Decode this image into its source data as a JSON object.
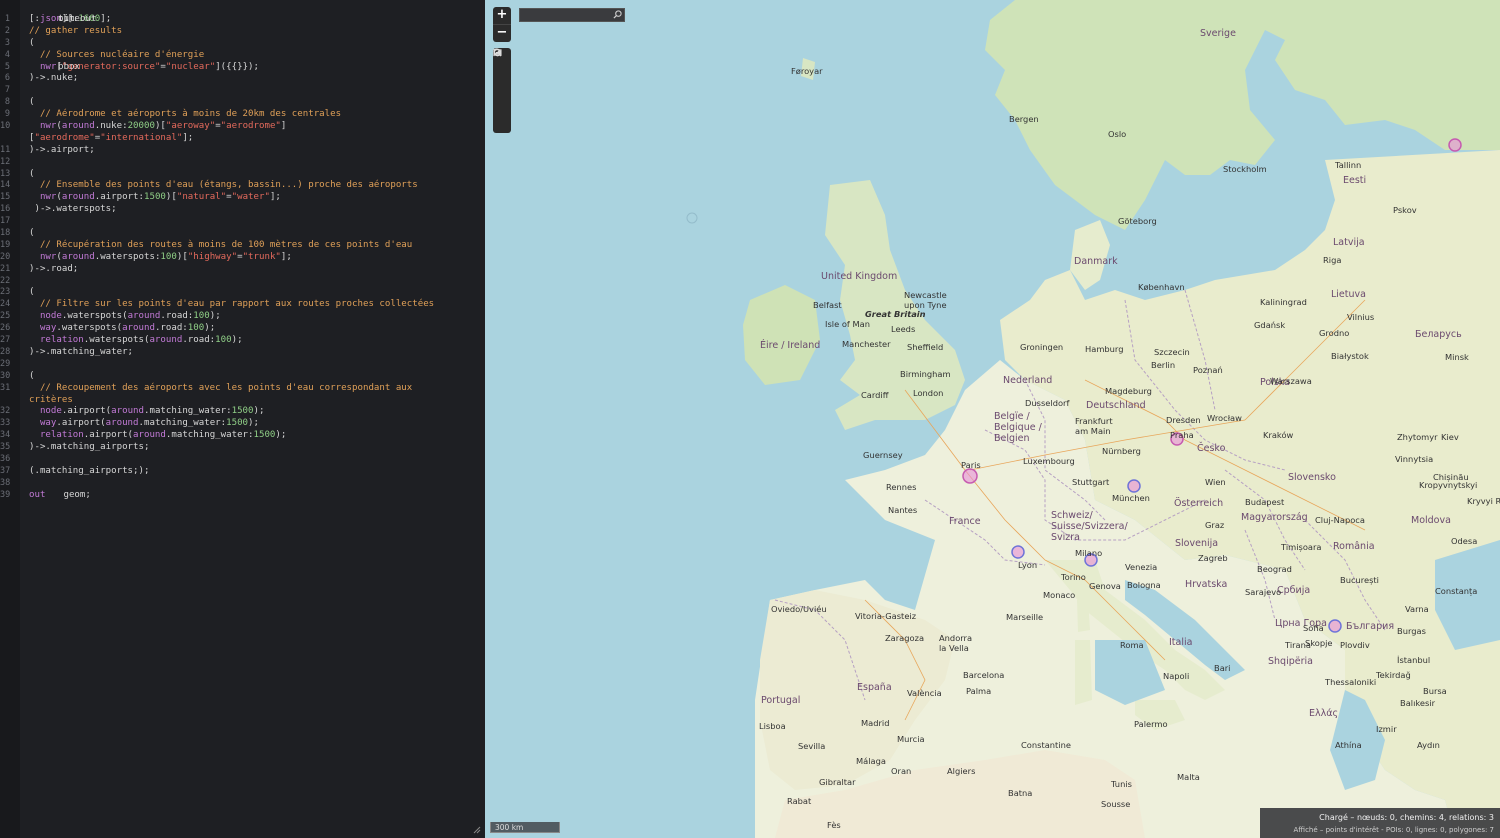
{
  "editor": {
    "lines": [
      {
        "n": "1",
        "segs": [
          [
            "op",
            "["
          ],
          [
            "txt",
            "out"
          ],
          [
            "op",
            ":"
          ],
          [
            "kw",
            "json"
          ],
          [
            "op",
            "]["
          ],
          [
            "txt",
            "timeout"
          ],
          [
            "op",
            ":"
          ],
          [
            "num",
            "1600"
          ],
          [
            "op",
            "];"
          ]
        ]
      },
      {
        "n": "2",
        "segs": [
          [
            "cm",
            "// gather results"
          ]
        ]
      },
      {
        "n": "3",
        "segs": [
          [
            "op",
            "("
          ]
        ]
      },
      {
        "n": "4",
        "segs": [
          [
            "cm",
            "  // Sources nucléaire d'énergie"
          ]
        ]
      },
      {
        "n": "5",
        "segs": [
          [
            "kw",
            "  nwr"
          ],
          [
            "op",
            "["
          ],
          [
            "str",
            "\"generator:source\""
          ],
          [
            "op",
            "="
          ],
          [
            "str",
            "\"nuclear\""
          ],
          [
            "op",
            "]({{"
          ],
          [
            "txt",
            "bbox"
          ],
          [
            "op",
            "}});"
          ]
        ]
      },
      {
        "n": "6",
        "segs": [
          [
            "op",
            ")->.nuke;"
          ]
        ]
      },
      {
        "n": "7",
        "segs": []
      },
      {
        "n": "8",
        "segs": [
          [
            "op",
            "("
          ]
        ]
      },
      {
        "n": "9",
        "segs": [
          [
            "cm",
            "  // Aérodrome et aéroports à moins de 20km des centrales"
          ]
        ]
      },
      {
        "n": "10",
        "segs": [
          [
            "kw",
            "  nwr"
          ],
          [
            "op",
            "("
          ],
          [
            "kw",
            "around"
          ],
          [
            "op",
            ".nuke:"
          ],
          [
            "num",
            "20000"
          ],
          [
            "op",
            ")["
          ],
          [
            "str",
            "\"aeroway\""
          ],
          [
            "op",
            "="
          ],
          [
            "str",
            "\"aerodrome\""
          ],
          [
            "op",
            "]"
          ]
        ]
      },
      {
        "n": "",
        "segs": [
          [
            "op",
            "["
          ],
          [
            "str",
            "\"aerodrome\""
          ],
          [
            "op",
            "="
          ],
          [
            "str",
            "\"international\""
          ],
          [
            "op",
            "];"
          ]
        ]
      },
      {
        "n": "11",
        "segs": [
          [
            "op",
            ")->.airport;"
          ]
        ]
      },
      {
        "n": "12",
        "segs": []
      },
      {
        "n": "13",
        "segs": [
          [
            "op",
            "("
          ]
        ]
      },
      {
        "n": "14",
        "segs": [
          [
            "cm",
            "  // Ensemble des points d'eau (étangs, bassin...) proche des aéroports"
          ]
        ]
      },
      {
        "n": "15",
        "segs": [
          [
            "kw",
            "  nwr"
          ],
          [
            "op",
            "("
          ],
          [
            "kw",
            "around"
          ],
          [
            "op",
            ".airport:"
          ],
          [
            "num",
            "1500"
          ],
          [
            "op",
            ")["
          ],
          [
            "str",
            "\"natural\""
          ],
          [
            "op",
            "="
          ],
          [
            "str",
            "\"water\""
          ],
          [
            "op",
            "];"
          ]
        ]
      },
      {
        "n": "16",
        "segs": [
          [
            "op",
            " )->.waterspots;"
          ]
        ]
      },
      {
        "n": "17",
        "segs": []
      },
      {
        "n": "18",
        "segs": [
          [
            "op",
            "("
          ]
        ]
      },
      {
        "n": "19",
        "segs": [
          [
            "cm",
            "  // Récupération des routes à moins de 100 mètres de ces points d'eau"
          ]
        ]
      },
      {
        "n": "20",
        "segs": [
          [
            "kw",
            "  nwr"
          ],
          [
            "op",
            "("
          ],
          [
            "kw",
            "around"
          ],
          [
            "op",
            ".waterspots:"
          ],
          [
            "num",
            "100"
          ],
          [
            "op",
            ")["
          ],
          [
            "str",
            "\"highway\""
          ],
          [
            "op",
            "="
          ],
          [
            "str",
            "\"trunk\""
          ],
          [
            "op",
            "];"
          ]
        ]
      },
      {
        "n": "21",
        "segs": [
          [
            "op",
            ")->.road;"
          ]
        ]
      },
      {
        "n": "22",
        "segs": []
      },
      {
        "n": "23",
        "segs": [
          [
            "op",
            "("
          ]
        ]
      },
      {
        "n": "24",
        "segs": [
          [
            "cm",
            "  // Filtre sur les points d'eau par rapport aux routes proches collectées"
          ]
        ]
      },
      {
        "n": "25",
        "segs": [
          [
            "kw",
            "  node"
          ],
          [
            "op",
            ".waterspots("
          ],
          [
            "kw",
            "around"
          ],
          [
            "op",
            ".road:"
          ],
          [
            "num",
            "100"
          ],
          [
            "op",
            ");"
          ]
        ]
      },
      {
        "n": "26",
        "segs": [
          [
            "kw",
            "  way"
          ],
          [
            "op",
            ".waterspots("
          ],
          [
            "kw",
            "around"
          ],
          [
            "op",
            ".road:"
          ],
          [
            "num",
            "100"
          ],
          [
            "op",
            ");"
          ]
        ]
      },
      {
        "n": "27",
        "segs": [
          [
            "kw",
            "  relation"
          ],
          [
            "op",
            ".waterspots("
          ],
          [
            "kw",
            "around"
          ],
          [
            "op",
            ".road:"
          ],
          [
            "num",
            "100"
          ],
          [
            "op",
            ");"
          ]
        ]
      },
      {
        "n": "28",
        "segs": [
          [
            "op",
            ")->.matching_water;"
          ]
        ]
      },
      {
        "n": "29",
        "segs": []
      },
      {
        "n": "30",
        "segs": [
          [
            "op",
            "("
          ]
        ]
      },
      {
        "n": "31",
        "segs": [
          [
            "cm",
            "  // Recoupement des aéroports avec les points d'eau correspondant aux"
          ]
        ]
      },
      {
        "n": "",
        "segs": [
          [
            "cm",
            "critères"
          ]
        ]
      },
      {
        "n": "32",
        "segs": [
          [
            "kw",
            "  node"
          ],
          [
            "op",
            ".airport("
          ],
          [
            "kw",
            "around"
          ],
          [
            "op",
            ".matching_water:"
          ],
          [
            "num",
            "1500"
          ],
          [
            "op",
            ");"
          ]
        ]
      },
      {
        "n": "33",
        "segs": [
          [
            "kw",
            "  way"
          ],
          [
            "op",
            ".airport("
          ],
          [
            "kw",
            "around"
          ],
          [
            "op",
            ".matching_water:"
          ],
          [
            "num",
            "1500"
          ],
          [
            "op",
            ");"
          ]
        ]
      },
      {
        "n": "34",
        "segs": [
          [
            "kw",
            "  relation"
          ],
          [
            "op",
            ".airport("
          ],
          [
            "kw",
            "around"
          ],
          [
            "op",
            ".matching_water:"
          ],
          [
            "num",
            "1500"
          ],
          [
            "op",
            ");"
          ]
        ]
      },
      {
        "n": "35",
        "segs": [
          [
            "op",
            ")->.matching_airports;"
          ]
        ]
      },
      {
        "n": "36",
        "segs": []
      },
      {
        "n": "37",
        "segs": [
          [
            "op",
            "(.matching_airports;);"
          ]
        ]
      },
      {
        "n": "38",
        "segs": []
      },
      {
        "n": "39",
        "segs": [
          [
            "kw",
            "out"
          ],
          [
            "txt",
            " geom;"
          ]
        ]
      }
    ]
  },
  "map": {
    "zoom_in": "+",
    "zoom_out": "−",
    "tools": [
      "search-tool",
      "locate-tool",
      "export-image-tool",
      "fit-data-tool",
      "disable-tool"
    ],
    "search_placeholder": "",
    "scale_label": "300 km",
    "stats": {
      "loaded": "Chargé – nœuds: 0, chemins: 4, relations: 3",
      "shown": "Affiché – points d'intérêt - POIs: 0, lignes: 0, polygones: 7"
    },
    "colors": {
      "water": "#aad3df",
      "land": "#f2efe9",
      "forest": "#cfe3b8",
      "marker_fill": "#e88fd7",
      "marker_stroke": "#6f74d8"
    },
    "countries": [
      "Sverige",
      "Eesti",
      "Latvija",
      "Lietuva",
      "Danmark",
      "United Kingdom",
      "Éire / Ireland",
      "Nederland",
      "Belgïe / Belgique / Belgien",
      "Deutschland",
      "Polska",
      "Česko",
      "Slovensko",
      "Österreich",
      "Magyarország",
      "France",
      "Schweiz/ Suisse/Svizzera/ Svizra",
      "Slovenija",
      "Hrvatska",
      "România",
      "Србија",
      "Italia",
      "España",
      "Portugal",
      "Shqipëria",
      "Ελλάς",
      "Беларусь",
      "Moldova",
      "България",
      "Црна Гора"
    ],
    "cities": [
      "Bergen",
      "Oslo",
      "Stockholm",
      "Tallinn",
      "Göteborg",
      "København",
      "Riga",
      "Vilnius",
      "Gdańsk",
      "Hamburg",
      "Szczecin",
      "Berlin",
      "Poznań",
      "Warszawa",
      "Newcastle upon Tyne",
      "Leeds",
      "Manchester",
      "Sheffield",
      "Birmingham",
      "Cardiff",
      "London",
      "Belfast",
      "Groningen",
      "Magdeburg",
      "Dresden",
      "Wrocław",
      "Kraków",
      "Dusseldorf",
      "Frankfurt am Main",
      "Luxembourg",
      "Nürnberg",
      "Praha",
      "Paris",
      "Stuttgart",
      "München",
      "Wien",
      "Rennes",
      "Nantes",
      "Graz",
      "Budapest",
      "Lyon",
      "Milano",
      "Torino",
      "Genova",
      "Venezia",
      "Bologna",
      "Zagreb",
      "Beograd",
      "Cluj-Napoca",
      "Timișoara",
      "București",
      "Sarajevo",
      "Marseille",
      "Monaco",
      "Andorra la Vella",
      "Barcelona",
      "Zaragoza",
      "Oviedo/Uviéu",
      "Vitoria-Gasteiz",
      "Madrid",
      "València",
      "Palma",
      "Lisboa",
      "Sevilla",
      "Murcia",
      "Málaga",
      "Gibraltar",
      "Roma",
      "Napoli",
      "Bari",
      "Palermo",
      "Skopje",
      "Sofia",
      "Plovdiv",
      "Thessaloniki",
      "Athína",
      "Tirana",
      "Constanța",
      "Varna",
      "Burgas",
      "İstanbul",
      "Tekirdağ",
      "Bursa",
      "Balıkesir",
      "Izmir",
      "Aydın",
      "Kiev",
      "Odesa",
      "Chișinău",
      "Minsk",
      "Pskov",
      "Kaliningrad",
      "Grodno",
      "Białystok",
      "Vinnytsia",
      "Zhytomyr",
      "Kropyvnytskyi",
      "Kryvyi Rih",
      "Algiers",
      "Tunis",
      "Sousse",
      "Constantine",
      "Oran",
      "Rabat",
      "Fès",
      "Batna",
      "Malta",
      "Great Britain",
      "Føroyar",
      "Isle of Man",
      "Guernsey"
    ]
  }
}
